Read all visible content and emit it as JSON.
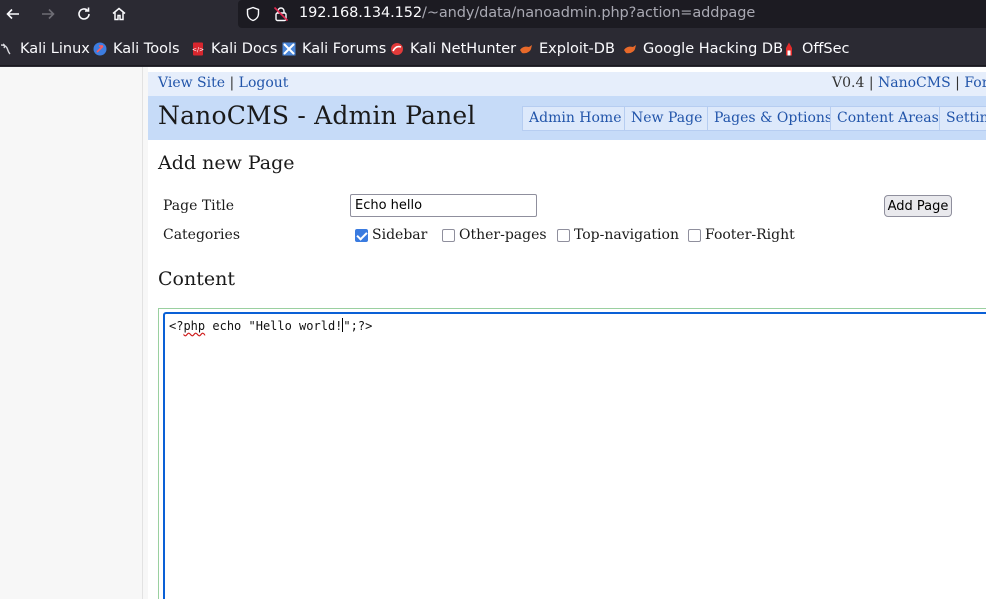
{
  "browser": {
    "url_host": "192.168.134.152",
    "url_path": "/~andy/data/nanoadmin.php?action=addpage",
    "bookmarks": [
      {
        "label": "Kali Linux",
        "icon": "kali-dragon-icon"
      },
      {
        "label": "Kali Tools",
        "icon": "kali-tools-icon"
      },
      {
        "label": "Kali Docs",
        "icon": "kali-docs-icon"
      },
      {
        "label": "Kali Forums",
        "icon": "kali-forums-icon"
      },
      {
        "label": "Kali NetHunter",
        "icon": "kali-nethunter-icon"
      },
      {
        "label": "Exploit-DB",
        "icon": "exploit-db-icon"
      },
      {
        "label": "Google Hacking DB",
        "icon": "ghdb-icon"
      },
      {
        "label": "OffSec",
        "icon": "offsec-icon"
      }
    ]
  },
  "cms": {
    "top_left": {
      "view_site": "View Site",
      "sep": " | ",
      "logout": "Logout"
    },
    "top_right": {
      "version": "V0.4",
      "sep1": " | ",
      "nanocms": "NanoCMS",
      "sep2": " | ",
      "forum": "Forum"
    },
    "title": "NanoCMS - Admin Panel",
    "nav": [
      "Admin Home",
      "New Page",
      "Pages & Options",
      "Content Areas",
      "Setting"
    ],
    "form": {
      "heading": "Add new Page",
      "page_title_label": "Page Title",
      "page_title_value": "Echo hello",
      "add_button": "Add Page",
      "categories_label": "Categories",
      "categories": [
        {
          "label": "Sidebar",
          "checked": true
        },
        {
          "label": "Other-pages",
          "checked": false
        },
        {
          "label": "Top-navigation",
          "checked": false
        },
        {
          "label": "Footer-Right",
          "checked": false
        }
      ],
      "content_heading": "Content",
      "content_parts": {
        "open": "<?",
        "php": "php",
        "middle": " echo \"Hello world!",
        "after_caret": "\";?>"
      }
    }
  }
}
